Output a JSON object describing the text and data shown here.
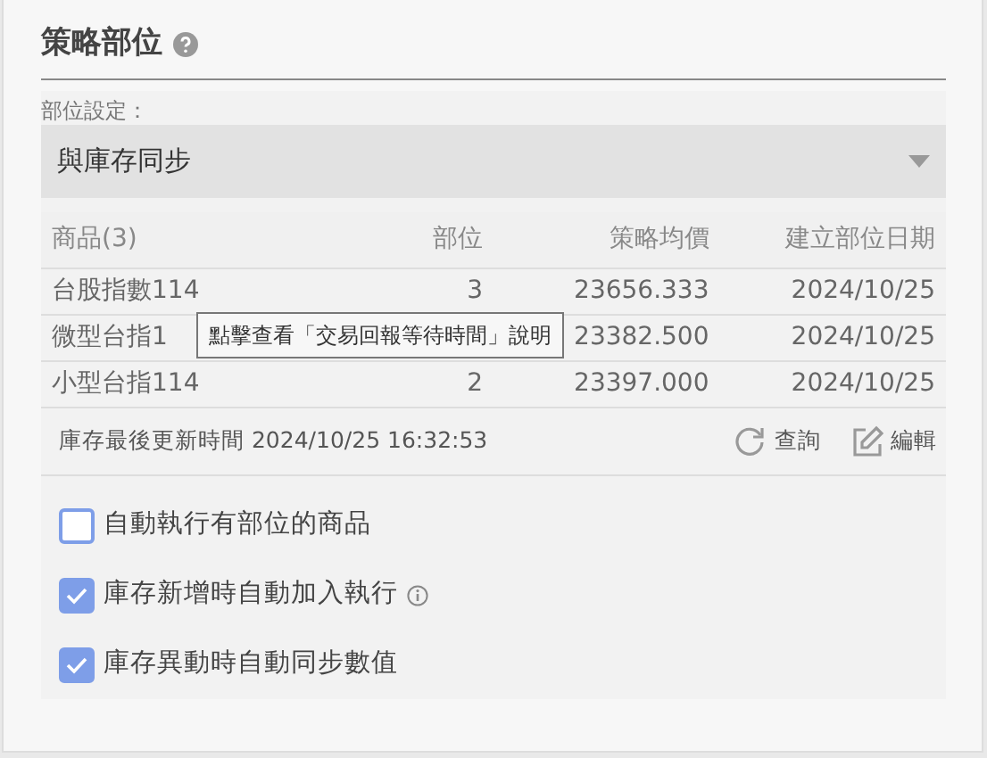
{
  "section": {
    "title": "策略部位"
  },
  "setting": {
    "label": "部位設定：",
    "value": "與庫存同步"
  },
  "table": {
    "columns": [
      "商品(3)",
      "部位",
      "策略均價",
      "建立部位日期"
    ],
    "rows": [
      {
        "cells": [
          "台股指數114",
          "3",
          "23656.333",
          "2024/10/25"
        ]
      },
      {
        "cells": [
          "微型台指1",
          "",
          "23382.500",
          "2024/10/25"
        ]
      },
      {
        "cells": [
          "小型台指114",
          "2",
          "23397.000",
          "2024/10/25"
        ]
      }
    ]
  },
  "tooltip": {
    "text": "點擊查看「交易回報等待時間」說明"
  },
  "footer": {
    "updated": "庫存最後更新時間 2024/10/25 16:32:53",
    "actions": [
      {
        "kind": "refresh",
        "label": "查詢"
      },
      {
        "kind": "edit",
        "label": "編輯"
      }
    ]
  },
  "options": [
    {
      "label": "自動執行有部位的商品",
      "checked": false,
      "info": false
    },
    {
      "label": "庫存新增時自動加入執行",
      "checked": true,
      "info": true
    },
    {
      "label": "庫存異動時自動同步數值",
      "checked": true,
      "info": false
    }
  ]
}
